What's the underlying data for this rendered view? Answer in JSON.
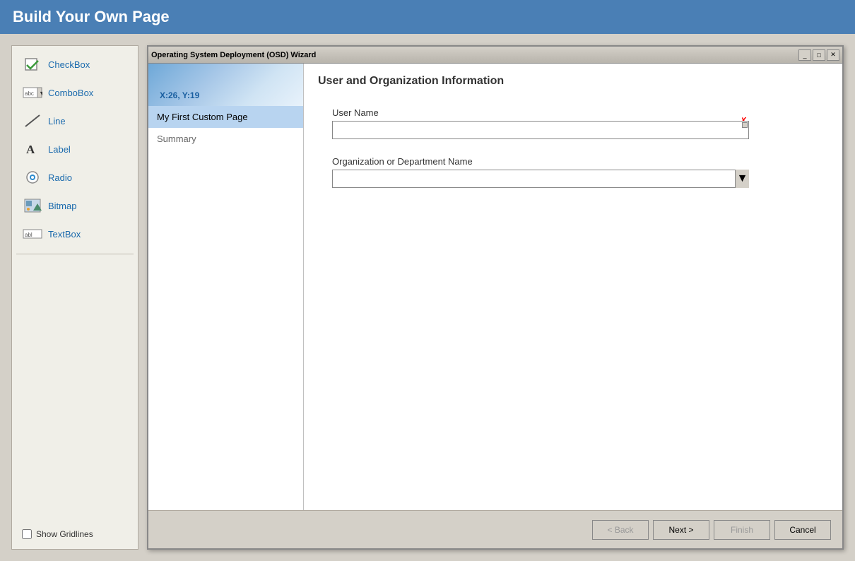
{
  "header": {
    "title": "Build Your Own Page"
  },
  "toolbox": {
    "items": [
      {
        "id": "checkbox",
        "label": "CheckBox",
        "icon": "checkbox-icon"
      },
      {
        "id": "combobox",
        "label": "ComboBox",
        "icon": "combobox-icon"
      },
      {
        "id": "line",
        "label": "Line",
        "icon": "line-icon"
      },
      {
        "id": "label",
        "label": "Label",
        "icon": "label-icon"
      },
      {
        "id": "radio",
        "label": "Radio",
        "icon": "radio-icon"
      },
      {
        "id": "bitmap",
        "label": "Bitmap",
        "icon": "bitmap-icon"
      },
      {
        "id": "textbox",
        "label": "TextBox",
        "icon": "textbox-icon"
      }
    ],
    "show_gridlines_label": "Show Gridlines"
  },
  "wizard": {
    "title": "Operating System Deployment (OSD) Wizard",
    "controls": [
      "minimize",
      "maximize",
      "close"
    ],
    "banner_coords": "X:26, Y:19",
    "nav_items": [
      {
        "id": "custom-page",
        "label": "My First Custom Page",
        "active": true
      },
      {
        "id": "summary",
        "label": "Summary",
        "active": false
      }
    ],
    "page_title": "User and Organization Information",
    "fields": [
      {
        "id": "username",
        "label": "User Name",
        "type": "textbox",
        "value": ""
      },
      {
        "id": "orgname",
        "label": "Organization or Department Name",
        "type": "combobox",
        "value": ""
      }
    ],
    "footer": {
      "back_label": "< Back",
      "next_label": "Next >",
      "finish_label": "Finish",
      "cancel_label": "Cancel"
    }
  }
}
